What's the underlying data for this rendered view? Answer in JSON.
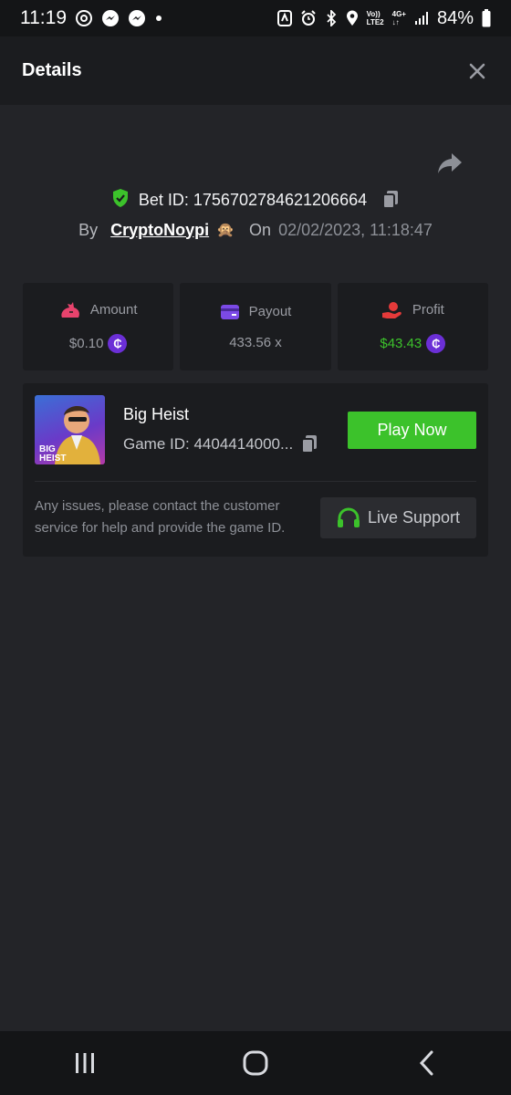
{
  "status_bar": {
    "time": "11:19",
    "network_top": "Vo))",
    "network_bottom": "LTE2",
    "net_type_top": "4G+",
    "net_type_bottom": "↓↑",
    "battery": "84%"
  },
  "header": {
    "title": "Details"
  },
  "bet": {
    "id_text": "Bet ID: 1756702784621206664",
    "by_label": "By",
    "username": "CryptoNoypi",
    "user_emoji": "🙊",
    "on_label": "On",
    "date": "02/02/2023, 11:18:47"
  },
  "stats": {
    "amount": {
      "label": "Amount",
      "value": "$0.10"
    },
    "payout": {
      "label": "Payout",
      "value": "433.56 x"
    },
    "profit": {
      "label": "Profit",
      "value": "$43.43"
    },
    "coin_symbol": "₵"
  },
  "game": {
    "name": "Big Heist",
    "id_text": "Game ID: 4404414000...",
    "thumb_title_line1": "BIG",
    "thumb_title_line2": "HEIST",
    "play_label": "Play Now",
    "notice": "Any issues, please contact the customer service for help and provide the game ID.",
    "support_label": "Live Support"
  },
  "colors": {
    "accent_green": "#3cc22b",
    "amount_icon": "#e8436d",
    "payout_icon": "#7b4ae6",
    "profit_icon": "#e53a3a",
    "coin": "#6b2fd6",
    "background": "#232428",
    "card": "#1b1c1f"
  },
  "icons": {
    "shield": "shield-check-icon",
    "copy": "copy-icon",
    "share": "share-icon",
    "close": "close-icon",
    "amount": "money-bag-icon",
    "payout": "card-icon",
    "profit": "hand-coin-icon",
    "support": "headset-icon"
  }
}
